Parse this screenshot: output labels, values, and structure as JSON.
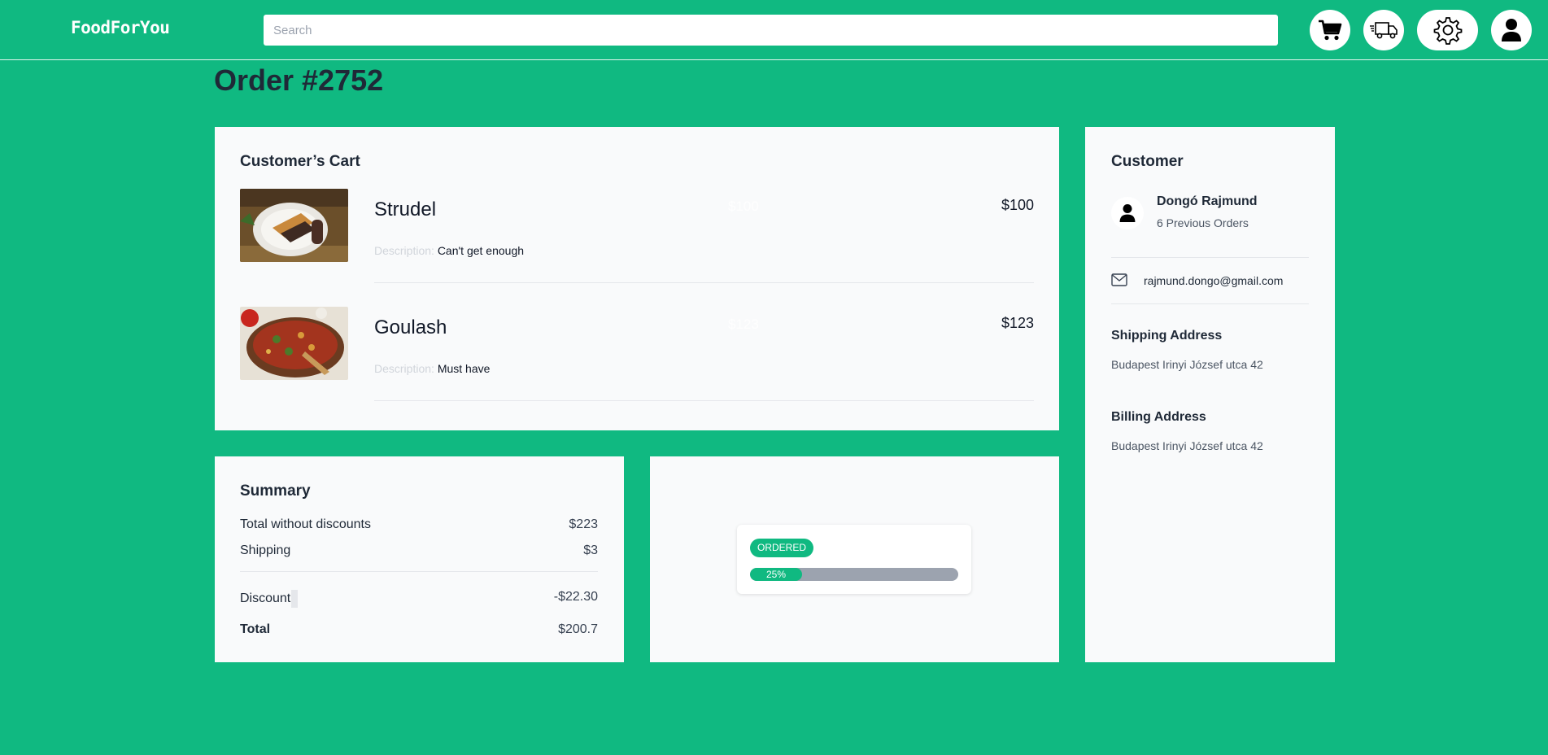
{
  "header": {
    "brand": "FoodForYou",
    "search_placeholder": "Search",
    "icons": [
      "cart-icon",
      "delivery-truck-icon",
      "gear-icon",
      "user-icon"
    ]
  },
  "order": {
    "title": "Order #2752"
  },
  "cart": {
    "heading": "Customer’s Cart",
    "items": [
      {
        "name": "Strudel",
        "ghost_price": "$100",
        "price": "$100",
        "desc_label": "Description:",
        "desc": "Can't get enough"
      },
      {
        "name": "Goulash",
        "ghost_price": "$123",
        "price": "$123",
        "desc_label": "Description:",
        "desc": "Must have"
      }
    ]
  },
  "customer": {
    "heading": "Customer",
    "name": "Dongó Rajmund",
    "previous_orders": "6 Previous Orders",
    "email": "rajmund.dongo@gmail.com",
    "shipping_heading": "Shipping Address",
    "shipping_address": "Budapest Irinyi József utca 42",
    "billing_heading": "Billing Address",
    "billing_address": "Budapest Irinyi József utca 42"
  },
  "summary": {
    "heading": "Summary",
    "rows": [
      {
        "label": "Total without discounts",
        "value": "$223"
      },
      {
        "label": "Shipping",
        "value": "$3"
      },
      {
        "label": "Discount",
        "value": "-$22.30"
      },
      {
        "label": "Total",
        "value": "$200.7"
      }
    ]
  },
  "status": {
    "badge": "ORDERED",
    "progress_label": "25%",
    "progress_fraction": 0.25
  },
  "colors": {
    "accent": "#10b981",
    "card_bg": "#f9fafb",
    "progress_track": "#9ca3af"
  }
}
